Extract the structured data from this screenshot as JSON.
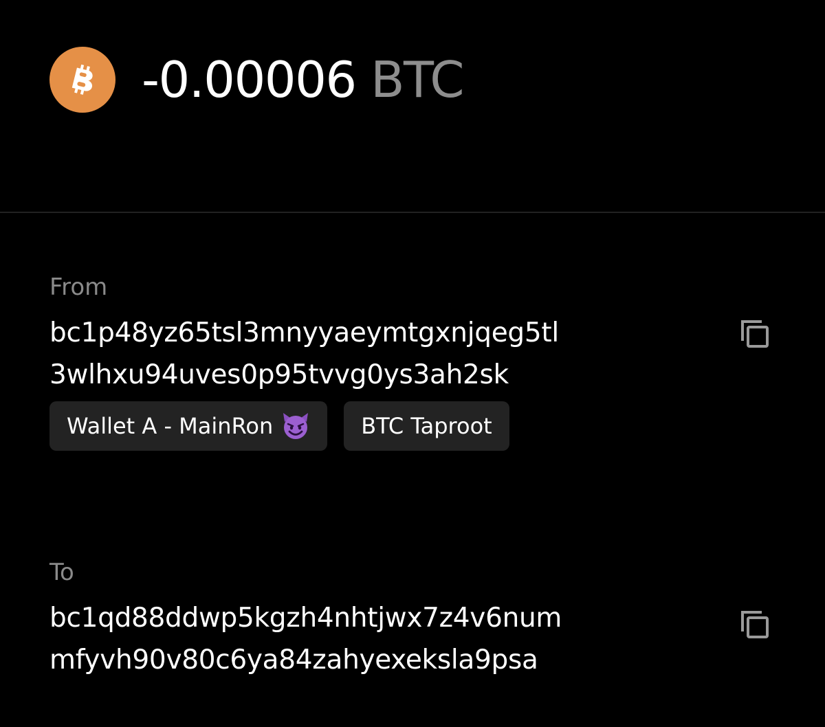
{
  "transaction": {
    "amount": "-0.00006",
    "unit": "BTC",
    "coin_icon": "bitcoin-icon",
    "coin_color": "#e59047"
  },
  "from": {
    "label": "From",
    "address": "bc1p48yz65tsl3mnyyaeymtgxnjqeg5tl3wlhxu94uves0p95tvvg0ys3ah2sk",
    "tags": [
      {
        "label": "Wallet A - MainRon",
        "icon": "smiling-devil-emoji"
      },
      {
        "label": "BTC Taproot"
      }
    ],
    "copy_icon": "copy-icon"
  },
  "to": {
    "label": "To",
    "address": "bc1qd88ddwp5kgzh4nhtjwx7z4v6nummfyvh90v80c6ya84zahyexeksla9psa",
    "copy_icon": "copy-icon"
  },
  "colors": {
    "background": "#000000",
    "muted_text": "#8a8a8a",
    "tag_background": "#232323",
    "divider": "#222222"
  }
}
